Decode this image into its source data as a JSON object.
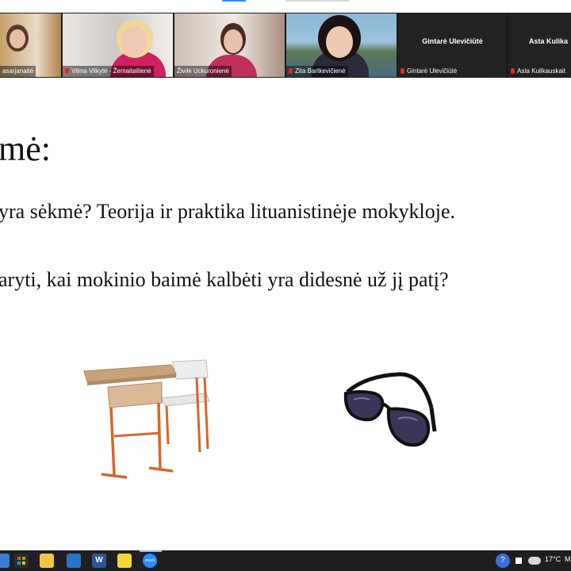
{
  "participants": [
    {
      "name": "asarjanaitė",
      "muted": false
    },
    {
      "name": "Vilma Vilkytė - Žemaitaitienė",
      "muted": true
    },
    {
      "name": "Živilė Uckuronienė",
      "muted": false,
      "active": true
    },
    {
      "name": "Zita Bartkevičienė",
      "muted": true
    },
    {
      "name": "Gintarė Ulevičiūtė",
      "display": "Gintarė Ulevičiūtė",
      "muted": true
    },
    {
      "name": "Asta Kulikauskait",
      "display": "Asta  Kulika",
      "muted": true
    }
  ],
  "slide": {
    "title": "mė:",
    "line1": "yra sėkmė? Teorija ir praktika lituanistinėje mokykloje.",
    "line2": "aryti, kai mokinio baimė kalbėti yra didesnė už jį patį?"
  },
  "taskbar": {
    "temperature": "17°C",
    "weather_extra": "M",
    "apps": [
      "store-icon",
      "file-explorer-icon",
      "mail-icon",
      "word-icon",
      "sticky-notes-icon",
      "zoom-icon"
    ],
    "zoom_label": "zoom"
  },
  "colors": {
    "zoom_blue": "#2d8cff",
    "active_outline": "#d6c94a",
    "mic_muted": "#e02828"
  }
}
